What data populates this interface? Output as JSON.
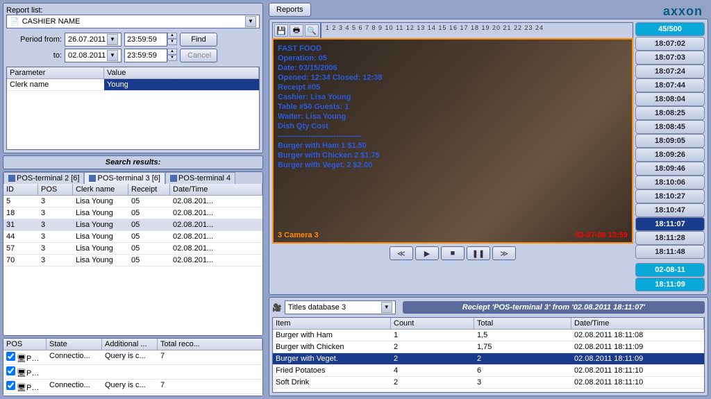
{
  "logo": "axxon",
  "left": {
    "report_list_label": "Report list:",
    "report_list_value": "CASHIER NAME",
    "period_from_label": "Period from:",
    "period_to_label": "to:",
    "date_from": "26.07.2011",
    "time_from": "23:59:59",
    "date_to": "02.08.2011",
    "time_to": "23:59:59",
    "find_btn": "Find",
    "cancel_btn": "Cancel",
    "param_hdr": "Parameter",
    "value_hdr": "Value",
    "param_name": "Clerk name",
    "param_value": "Young",
    "search_results_label": "Search results:",
    "tabs": [
      {
        "label": "POS-terminal 2 [6]",
        "active": false
      },
      {
        "label": "POS-terminal 3 [6]",
        "active": true
      },
      {
        "label": "POS-terminal 4",
        "active": false
      }
    ],
    "results_cols": {
      "id": "ID",
      "pos": "POS",
      "clerk": "Clerk name",
      "receipt": "Receipt",
      "dt": "Date/Time"
    },
    "results": [
      {
        "id": "5",
        "pos": "3",
        "clerk": "Lisa Young",
        "rec": "05",
        "dt": "02.08.201..."
      },
      {
        "id": "18",
        "pos": "3",
        "clerk": "Lisa Young",
        "rec": "05",
        "dt": "02.08.201..."
      },
      {
        "id": "31",
        "pos": "3",
        "clerk": "Lisa Young",
        "rec": "05",
        "dt": "02.08.201...",
        "sel": true
      },
      {
        "id": "44",
        "pos": "3",
        "clerk": "Lisa Young",
        "rec": "05",
        "dt": "02.08.201..."
      },
      {
        "id": "57",
        "pos": "3",
        "clerk": "Lisa Young",
        "rec": "05",
        "dt": "02.08.201..."
      },
      {
        "id": "70",
        "pos": "3",
        "clerk": "Lisa Young",
        "rec": "05",
        "dt": "02.08.201..."
      }
    ],
    "bottom_cols": {
      "pos": "POS",
      "state": "State",
      "add": "Additional ...",
      "total": "Total reco..."
    },
    "bottom_rows": [
      {
        "pos": "PO...",
        "state": "Connectio...",
        "add": "Query is c...",
        "total": "7"
      },
      {
        "pos": "PO...",
        "state": "",
        "add": "",
        "total": ""
      },
      {
        "pos": "PO...",
        "state": "Connectio...",
        "add": "Query is c...",
        "total": "7"
      }
    ]
  },
  "right": {
    "reports_btn": "Reports",
    "ruler": "1 2 3 4 5 6 7 8 9 10 11 12 13 14 15 16 17 18 19 20 21 22 23 24",
    "video_overlay": [
      "FAST FOOD",
      "Operation: 05",
      "Date: 03/15/2006",
      "Opened: 12:34      Closed: 12:38",
      "Receipt #05",
      "Cashier: Lisa Young",
      "Table #50          Guests: 1",
      "Waiter: Lisa Young",
      "Dish               Qty      Cost",
      "---------------------------------",
      "Burger with Ham     1      $1.50",
      "Burger with Chicken 2      $1.75",
      "Burger with Veget.  2      $2.00"
    ],
    "cam_label": "3   Camera 3",
    "ts_label": "03-07-06  13:59",
    "counter": "45/500",
    "times": [
      "18:07:02",
      "18:07:03",
      "18:07:24",
      "18:07:44",
      "18:08:04",
      "18:08:25",
      "18:08:45",
      "18:09:05",
      "18:09:26",
      "18:09:46",
      "18:10:06",
      "18:10:27",
      "18:10:47",
      "18:11:07",
      "18:11:28",
      "18:11:48"
    ],
    "selected_time": "18:11:07",
    "date_pill": "02-08-11",
    "time_pill": "18:11:09",
    "titles_db": "Titles database 3",
    "receipt_header": "Reciept 'POS-terminal 3' from '02.08.2011 18:11:07'",
    "items_cols": {
      "item": "Item",
      "count": "Count",
      "total": "Total",
      "dt": "Date/Time"
    },
    "items": [
      {
        "item": "Burger with Ham",
        "count": "1",
        "total": "1,5",
        "dt": "02.08.2011 18:11:08"
      },
      {
        "item": "Burger with Chicken",
        "count": "2",
        "total": "1,75",
        "dt": "02.08.2011 18:11:09"
      },
      {
        "item": "Burger with Veget.",
        "count": "2",
        "total": "2",
        "dt": "02.08.2011 18:11:09",
        "sel": true
      },
      {
        "item": "Fried Potatoes",
        "count": "4",
        "total": "6",
        "dt": "02.08.2011 18:11:10"
      },
      {
        "item": "Soft Drink",
        "count": "2",
        "total": "3",
        "dt": "02.08.2011 18:11:10"
      }
    ]
  }
}
